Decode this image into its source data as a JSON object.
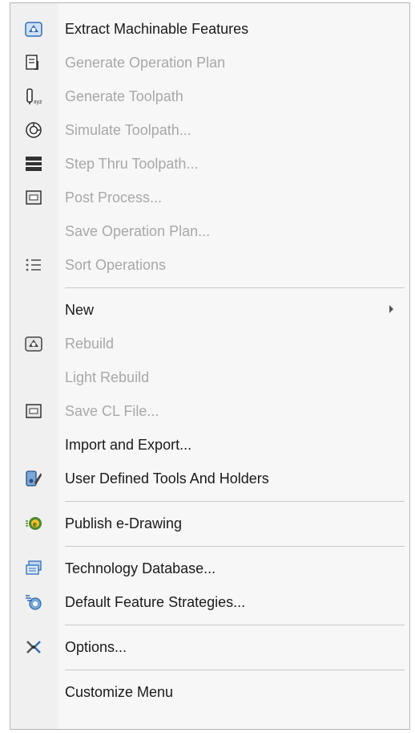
{
  "menu": {
    "items": [
      {
        "label": "Extract Machinable Features",
        "icon": "extract-features-icon",
        "enabled": true
      },
      {
        "label": "Generate Operation Plan",
        "icon": "operation-plan-icon",
        "enabled": false
      },
      {
        "label": "Generate Toolpath",
        "icon": "toolpath-icon",
        "enabled": false
      },
      {
        "label": "Simulate Toolpath...",
        "icon": "simulate-icon",
        "enabled": false
      },
      {
        "label": "Step Thru Toolpath...",
        "icon": "step-thru-icon",
        "enabled": false
      },
      {
        "label": "Post Process...",
        "icon": "post-process-icon",
        "enabled": false
      },
      {
        "label": "Save Operation Plan...",
        "icon": "",
        "enabled": false
      },
      {
        "label": "Sort Operations",
        "icon": "sort-icon",
        "enabled": false
      },
      {
        "label": "New",
        "icon": "",
        "enabled": true,
        "submenu": true
      },
      {
        "label": "Rebuild",
        "icon": "rebuild-icon",
        "enabled": false
      },
      {
        "label": "Light Rebuild",
        "icon": "",
        "enabled": false
      },
      {
        "label": "Save CL File...",
        "icon": "cl-file-icon",
        "enabled": false
      },
      {
        "label": "Import and Export...",
        "icon": "",
        "enabled": true
      },
      {
        "label": "User Defined Tools And Holders",
        "icon": "tools-holders-icon",
        "enabled": true
      },
      {
        "label": "Publish e-Drawing",
        "icon": "edrawing-icon",
        "enabled": true
      },
      {
        "label": "Technology Database...",
        "icon": "database-icon",
        "enabled": true
      },
      {
        "label": "Default Feature Strategies...",
        "icon": "strategies-icon",
        "enabled": true
      },
      {
        "label": "Options...",
        "icon": "options-icon",
        "enabled": true
      },
      {
        "label": "Customize Menu",
        "icon": "",
        "enabled": true
      }
    ]
  },
  "colors": {
    "enabled_text": "#1a1a1a",
    "disabled_text": "#a8a8a8",
    "icon_blue": "#2f6db5",
    "icon_dark": "#333333"
  }
}
